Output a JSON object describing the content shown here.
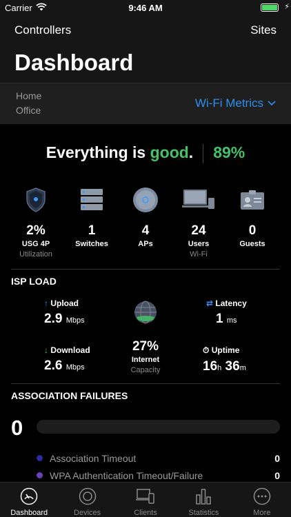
{
  "status_bar": {
    "carrier": "Carrier",
    "time": "9:46 AM"
  },
  "nav": {
    "left": "Controllers",
    "right": "Sites",
    "title": "Dashboard"
  },
  "site": {
    "name": "Home",
    "sub": "Office",
    "metric_selector": "Wi-Fi Metrics"
  },
  "health": {
    "prefix": "Everything is ",
    "status": "good",
    "suffix": ".",
    "percent": "89%"
  },
  "devices": [
    {
      "icon": "shield-icon",
      "value": "2%",
      "label": "USG 4P",
      "sub": "Utilization"
    },
    {
      "icon": "switch-icon",
      "value": "1",
      "label": "Switches",
      "sub": ""
    },
    {
      "icon": "access-point-icon",
      "value": "4",
      "label": "APs",
      "sub": ""
    },
    {
      "icon": "laptop-icon",
      "value": "24",
      "label": "Users",
      "sub": "Wi-Fi"
    },
    {
      "icon": "guest-badge-icon",
      "value": "0",
      "label": "Guests",
      "sub": ""
    }
  ],
  "isp": {
    "title": "ISP LOAD",
    "upload": {
      "label": "Upload",
      "value": "2.9",
      "unit": "Mbps"
    },
    "download": {
      "label": "Download",
      "value": "2.6",
      "unit": "Mbps"
    },
    "latency": {
      "label": "Latency",
      "value": "1",
      "unit": "ms"
    },
    "uptime": {
      "label": "Uptime",
      "hours": "16",
      "h_unit": "h",
      "minutes": "36",
      "m_unit": "m"
    },
    "internet": {
      "value": "27%",
      "label": "Internet",
      "sub": "Capacity"
    }
  },
  "association": {
    "title": "ASSOCIATION FAILURES",
    "total": "0",
    "items": [
      {
        "label": "Association Timeout",
        "count": "0",
        "color": "#2b2b9e"
      },
      {
        "label": "WPA Authentication Timeout/Failure",
        "count": "0",
        "color": "#6b3fb8"
      }
    ]
  },
  "tabs": [
    {
      "label": "Dashboard",
      "icon": "dashboard-gauge-icon",
      "active": true
    },
    {
      "label": "Devices",
      "icon": "devices-circle-icon",
      "active": false
    },
    {
      "label": "Clients",
      "icon": "clients-icon",
      "active": false
    },
    {
      "label": "Statistics",
      "icon": "statistics-bars-icon",
      "active": false
    },
    {
      "label": "More",
      "icon": "more-dots-icon",
      "active": false
    }
  ],
  "colors": {
    "accent": "#2d8ff0",
    "good": "#44c265",
    "background": "#000000",
    "panel": "#161616"
  }
}
